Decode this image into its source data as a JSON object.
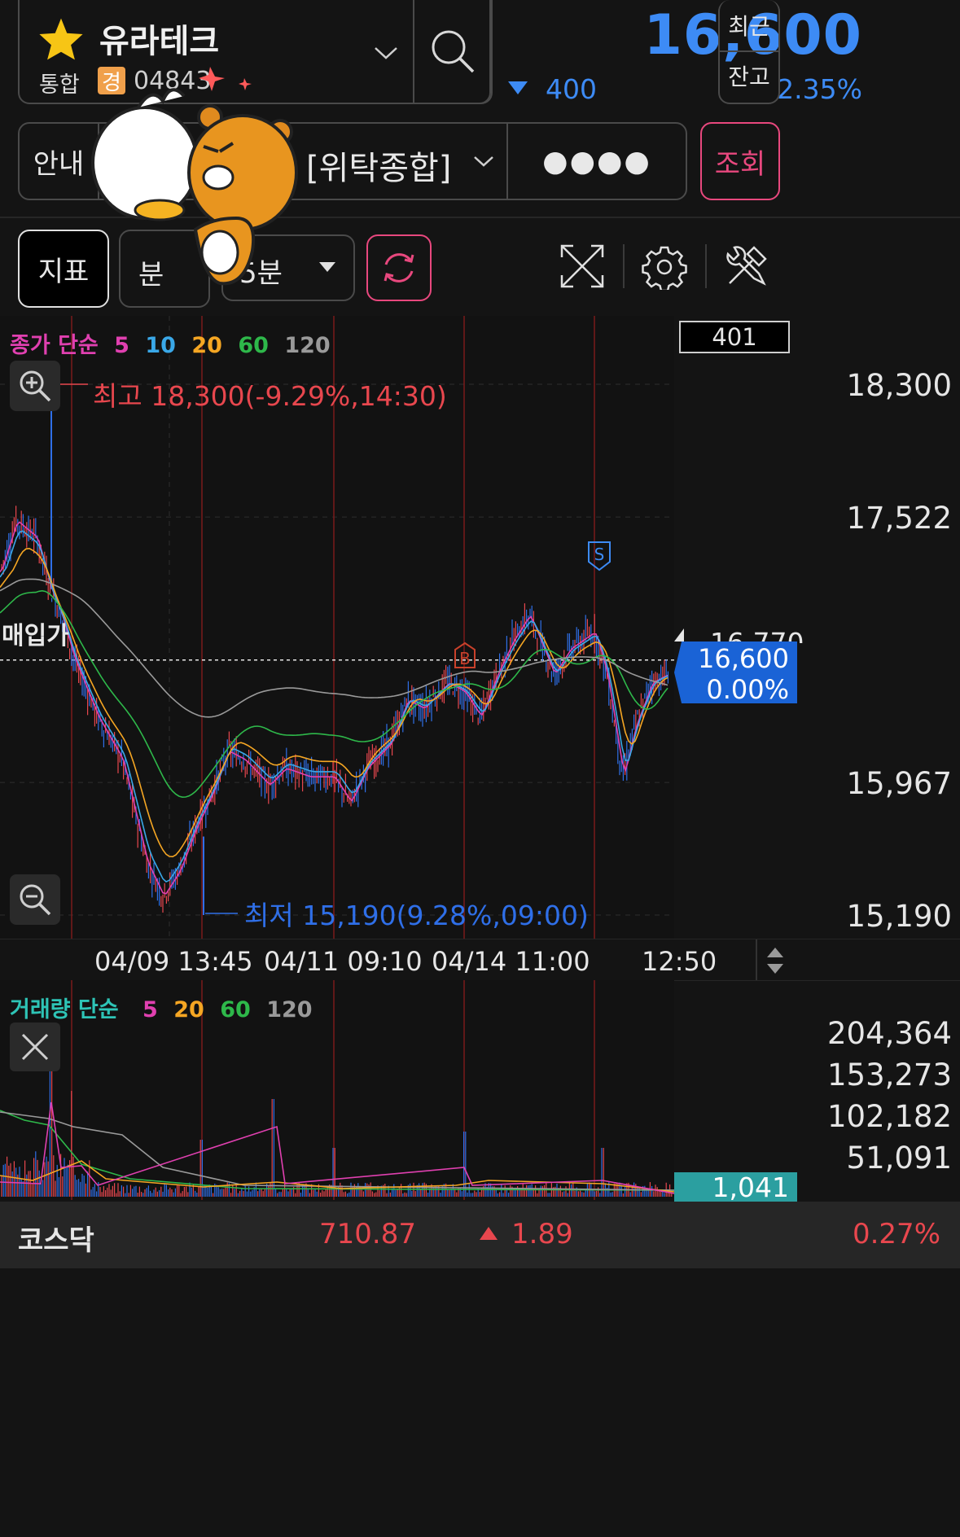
{
  "header": {
    "stock_name": "유라테크",
    "market_tag": "통합",
    "warning_badge": "경",
    "stock_code": "04843",
    "current_price": "16,600",
    "change_amount": "400",
    "change_percent": "2.35%",
    "side_btn_recent": "최근",
    "side_btn_balance": "잔고"
  },
  "account": {
    "guide_btn": "안내",
    "account_type": "[위탁종합]",
    "password_mask": "●●●●",
    "inquiry_btn": "조회"
  },
  "toolbar": {
    "indicator_btn": "지표",
    "minute_btn": "분",
    "interval_select": "5분"
  },
  "price_chart": {
    "legend_prefix": "종가 단순",
    "legend_periods": [
      "5",
      "10",
      "20",
      "60",
      "120"
    ],
    "legend_colors": [
      "#e040b0",
      "#3aa8e8",
      "#f5a623",
      "#2eb84a",
      "#9a9a9a"
    ],
    "cursor_value": "401",
    "y_ticks": [
      "18,300",
      "17,522",
      "15,967",
      "15,190"
    ],
    "hidden_tick": "16,770",
    "current_tag_price": "16,600",
    "current_tag_pct": "0.00%",
    "high_label": "최고 18,300(-9.29%,14:30)",
    "low_label": "최저 15,190(9.28%,09:00)",
    "buy_price_label": "매입가",
    "buy_marker": "B",
    "sell_marker": "S",
    "x_ticks": [
      "04/09 13:45",
      "04/11 09:10",
      "04/14 11:00",
      "12:50"
    ]
  },
  "volume_chart": {
    "legend_prefix": "거래량 단순",
    "legend_periods": [
      "5",
      "20",
      "60",
      "120"
    ],
    "legend_colors": [
      "#e040b0",
      "#f5a623",
      "#2eb84a",
      "#9a9a9a"
    ],
    "y_ticks": [
      "204,364",
      "153,273",
      "102,182",
      "51,091"
    ],
    "current_volume": "1,041"
  },
  "footer": {
    "index_name": "코스닥",
    "index_value": "710.87",
    "index_change": "1.89",
    "index_pct": "0.27%"
  },
  "colors": {
    "up": "#e8474e",
    "down": "#2f6fe8",
    "accent_pink": "#e8487e",
    "tag_blue": "#1a63d6"
  }
}
